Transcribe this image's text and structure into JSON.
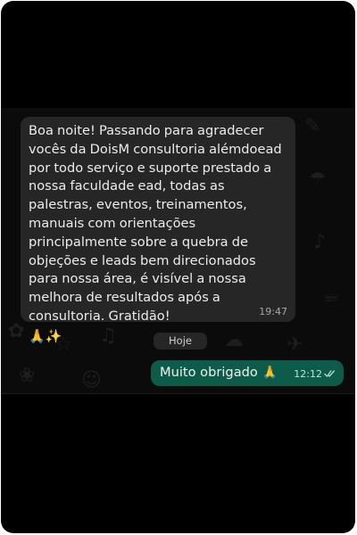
{
  "conversation": {
    "incoming": {
      "text": "Boa noite! Passando para agradecer vocês da DoisM consultoria alémdoead por todo serviço e suporte prestado a nossa faculdade ead, todas as palestras, eventos, treinamentos, manuais com orientações principalmente sobre a quebra de objeções e leads bem direcionados para nossa área, é visível a nossa melhora de resultados após a consultoria. Gratidão!",
      "emoji": "🙏✨",
      "time": "19:47"
    },
    "day_separator": "Hoje",
    "outgoing": {
      "text": "Muito obrigado",
      "emoji": "🙏",
      "time": "12:12",
      "status_icon": "double-check-icon"
    }
  },
  "colors": {
    "incoming_bubble": "#262626",
    "outgoing_bubble": "#0d5c4a",
    "background": "#000000"
  }
}
